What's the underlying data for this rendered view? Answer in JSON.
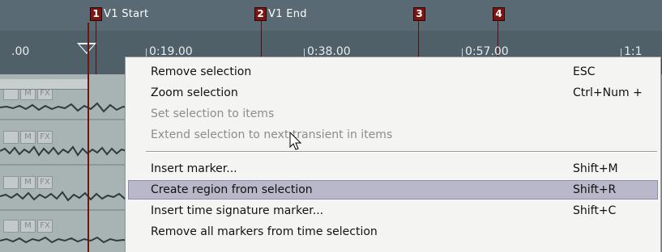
{
  "ruler": {
    "markers": [
      {
        "number": "1",
        "name": "V1 Start"
      },
      {
        "number": "2",
        "name": "V1 End"
      },
      {
        "number": "3",
        "name": ""
      },
      {
        "number": "4",
        "name": ""
      }
    ],
    "time_labels": [
      ".00",
      "0:19.00",
      "0:38.00",
      "0:57.00",
      "1:1"
    ]
  },
  "tracks": [
    {
      "buttons": [
        "",
        "M",
        "FX"
      ]
    },
    {
      "buttons": [
        "",
        "M",
        "FX"
      ]
    },
    {
      "buttons": [
        "",
        "M",
        "FX"
      ]
    },
    {
      "buttons": [
        "",
        "M",
        "FX"
      ]
    }
  ],
  "context_menu": {
    "items": [
      {
        "label": "Remove selection",
        "shortcut": "ESC"
      },
      {
        "label": "Zoom selection",
        "shortcut": "Ctrl+Num +"
      },
      {
        "label": "Set selection to items",
        "shortcut": ""
      },
      {
        "label": "Extend selection to next transient in items",
        "shortcut": ""
      },
      {
        "label": "Insert marker...",
        "shortcut": "Shift+M"
      },
      {
        "label": "Create region from selection",
        "shortcut": "Shift+R"
      },
      {
        "label": "Insert time signature marker...",
        "shortcut": "Shift+C"
      },
      {
        "label": "Remove all markers from time selection",
        "shortcut": ""
      }
    ]
  },
  "colors": {
    "marker_badge": "#7a1512",
    "menu_highlight": "#b9b8ca",
    "ruler_bg": "#506068"
  }
}
